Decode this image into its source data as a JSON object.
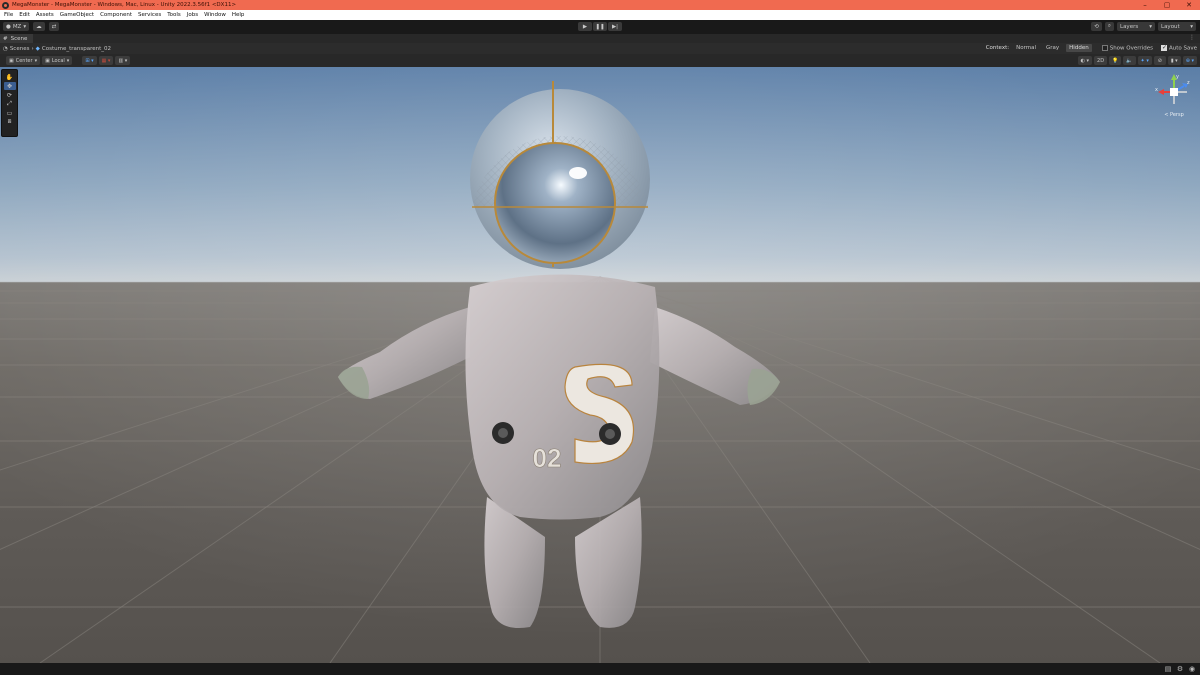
{
  "window": {
    "title": "MegaMonster - MegaMonster - Windows, Mac, Linux - Unity 2022.3.56f1 <DX11>",
    "controls": [
      "–",
      "▢",
      "✕"
    ]
  },
  "menu": [
    "File",
    "Edit",
    "Assets",
    "GameObject",
    "Component",
    "Services",
    "Tools",
    "Jobs",
    "Window",
    "Help"
  ],
  "toolbar": {
    "account_label": "MZ",
    "cloud_icon": "cloud-icon",
    "collab_icon": "version-control-icon",
    "play_icons": [
      "play-icon",
      "pause-icon",
      "step-icon"
    ],
    "layers_label": "Layers",
    "layout_label": "Layout"
  },
  "tab": {
    "label": "Scene"
  },
  "breadcrumb": {
    "root": "Scenes",
    "prefab": "Costume_transparent_02"
  },
  "context": {
    "label": "Context:",
    "options": [
      "Normal",
      "Gray",
      "Hidden"
    ],
    "selected": "Hidden",
    "show_overrides": {
      "label": "Show Overrides",
      "checked": false
    },
    "auto_save": {
      "label": "Auto Save",
      "checked": true
    }
  },
  "scene_toolbar": {
    "pivot_label": "Center",
    "space_label": "Local",
    "mode_2d_label": "2D"
  },
  "tools": [
    "hand-tool",
    "move-tool",
    "rotate-tool",
    "scale-tool",
    "rect-tool",
    "transform-tool"
  ],
  "active_tool": "move-tool",
  "gizmo": {
    "projection_label": "< Persp",
    "axis_labels": [
      "y",
      "x",
      "z"
    ],
    "axis_colors": {
      "x": "#e8403a",
      "y": "#8fd14f",
      "z": "#4b8cf0"
    }
  },
  "scene_object": {
    "suit_text": "S",
    "number_text": "02"
  },
  "colors": {
    "title_bar": "#f06a50",
    "sky_top": "#5b7ea7",
    "ground": "#6f6b66",
    "active_tool": "#3b5e91"
  }
}
